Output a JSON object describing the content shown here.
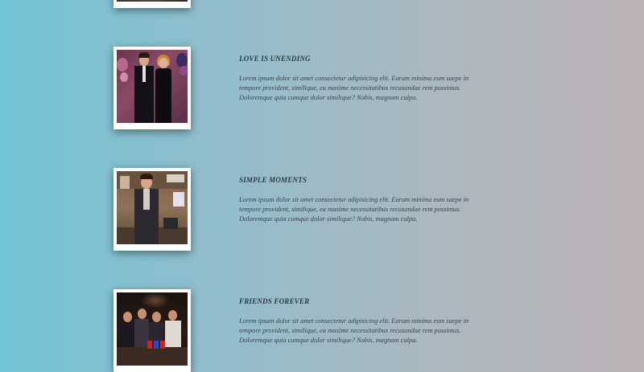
{
  "entries": [
    {
      "title": "LOVE IS UNENDING",
      "text": "Lorem ipsum dolor sit amet consectetur adipisicing elit. Earum minima eum saepe in tempore provident, similique, ea maxime necessitatibus recusandae rem possimus. Doloremque quia cumque dolor similique? Nobis, magnam culpa."
    },
    {
      "title": "SIMPLE MOMENTS",
      "text": "Lorem ipsum dolor sit amet consectetur adipisicing elit. Earum minima eum saepe in tempore provident, similique, ea maxime necessitatibus recusandae rem possimus. Doloremque quia cumque dolor similique? Nobis, magnam culpa."
    },
    {
      "title": "FRIENDS FOREVER",
      "text": "Lorem ipsum dolor sit amet consectetur adipisicing elit. Earum minima eum saepe in tempore provident, similique, ea maxime necessitatibus recusandae rem possimus. Doloremque quia cumque dolor similique? Nobis, magnam culpa."
    }
  ],
  "colors": {
    "gradient_left": "#72c4d6",
    "gradient_right": "#bdb3b7",
    "text": "#2a3a44",
    "frame": "#ffffff"
  }
}
